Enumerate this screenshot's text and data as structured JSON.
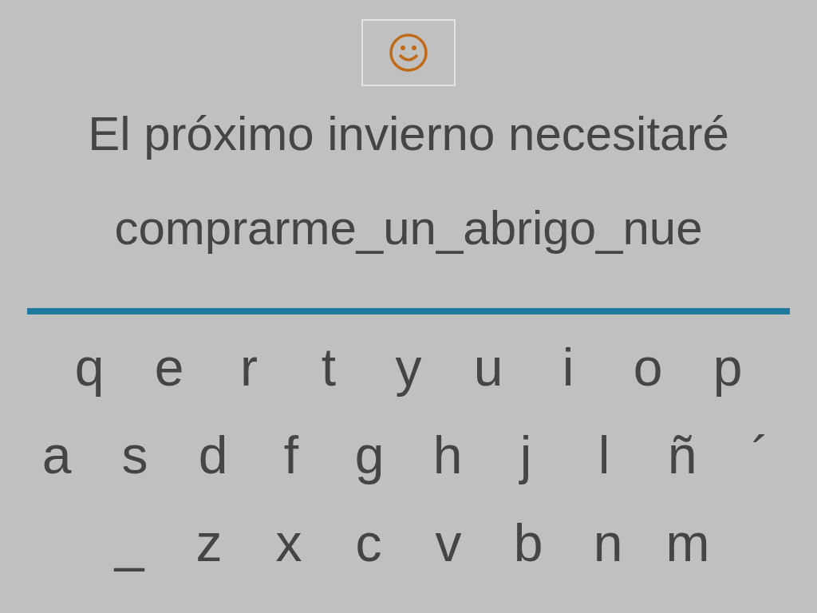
{
  "prompt": "El próximo invierno necesitaré",
  "answer": "comprarme_un_abrigo_nue",
  "keyboard": {
    "rows": [
      [
        "q",
        "e",
        "r",
        "t",
        "y",
        "u",
        "i",
        "o",
        "p"
      ],
      [
        "a",
        "s",
        "d",
        "f",
        "g",
        "h",
        "j",
        "l",
        "ñ",
        "´"
      ],
      [
        "_",
        "z",
        "x",
        "c",
        "v",
        "b",
        "n",
        "m"
      ]
    ]
  }
}
